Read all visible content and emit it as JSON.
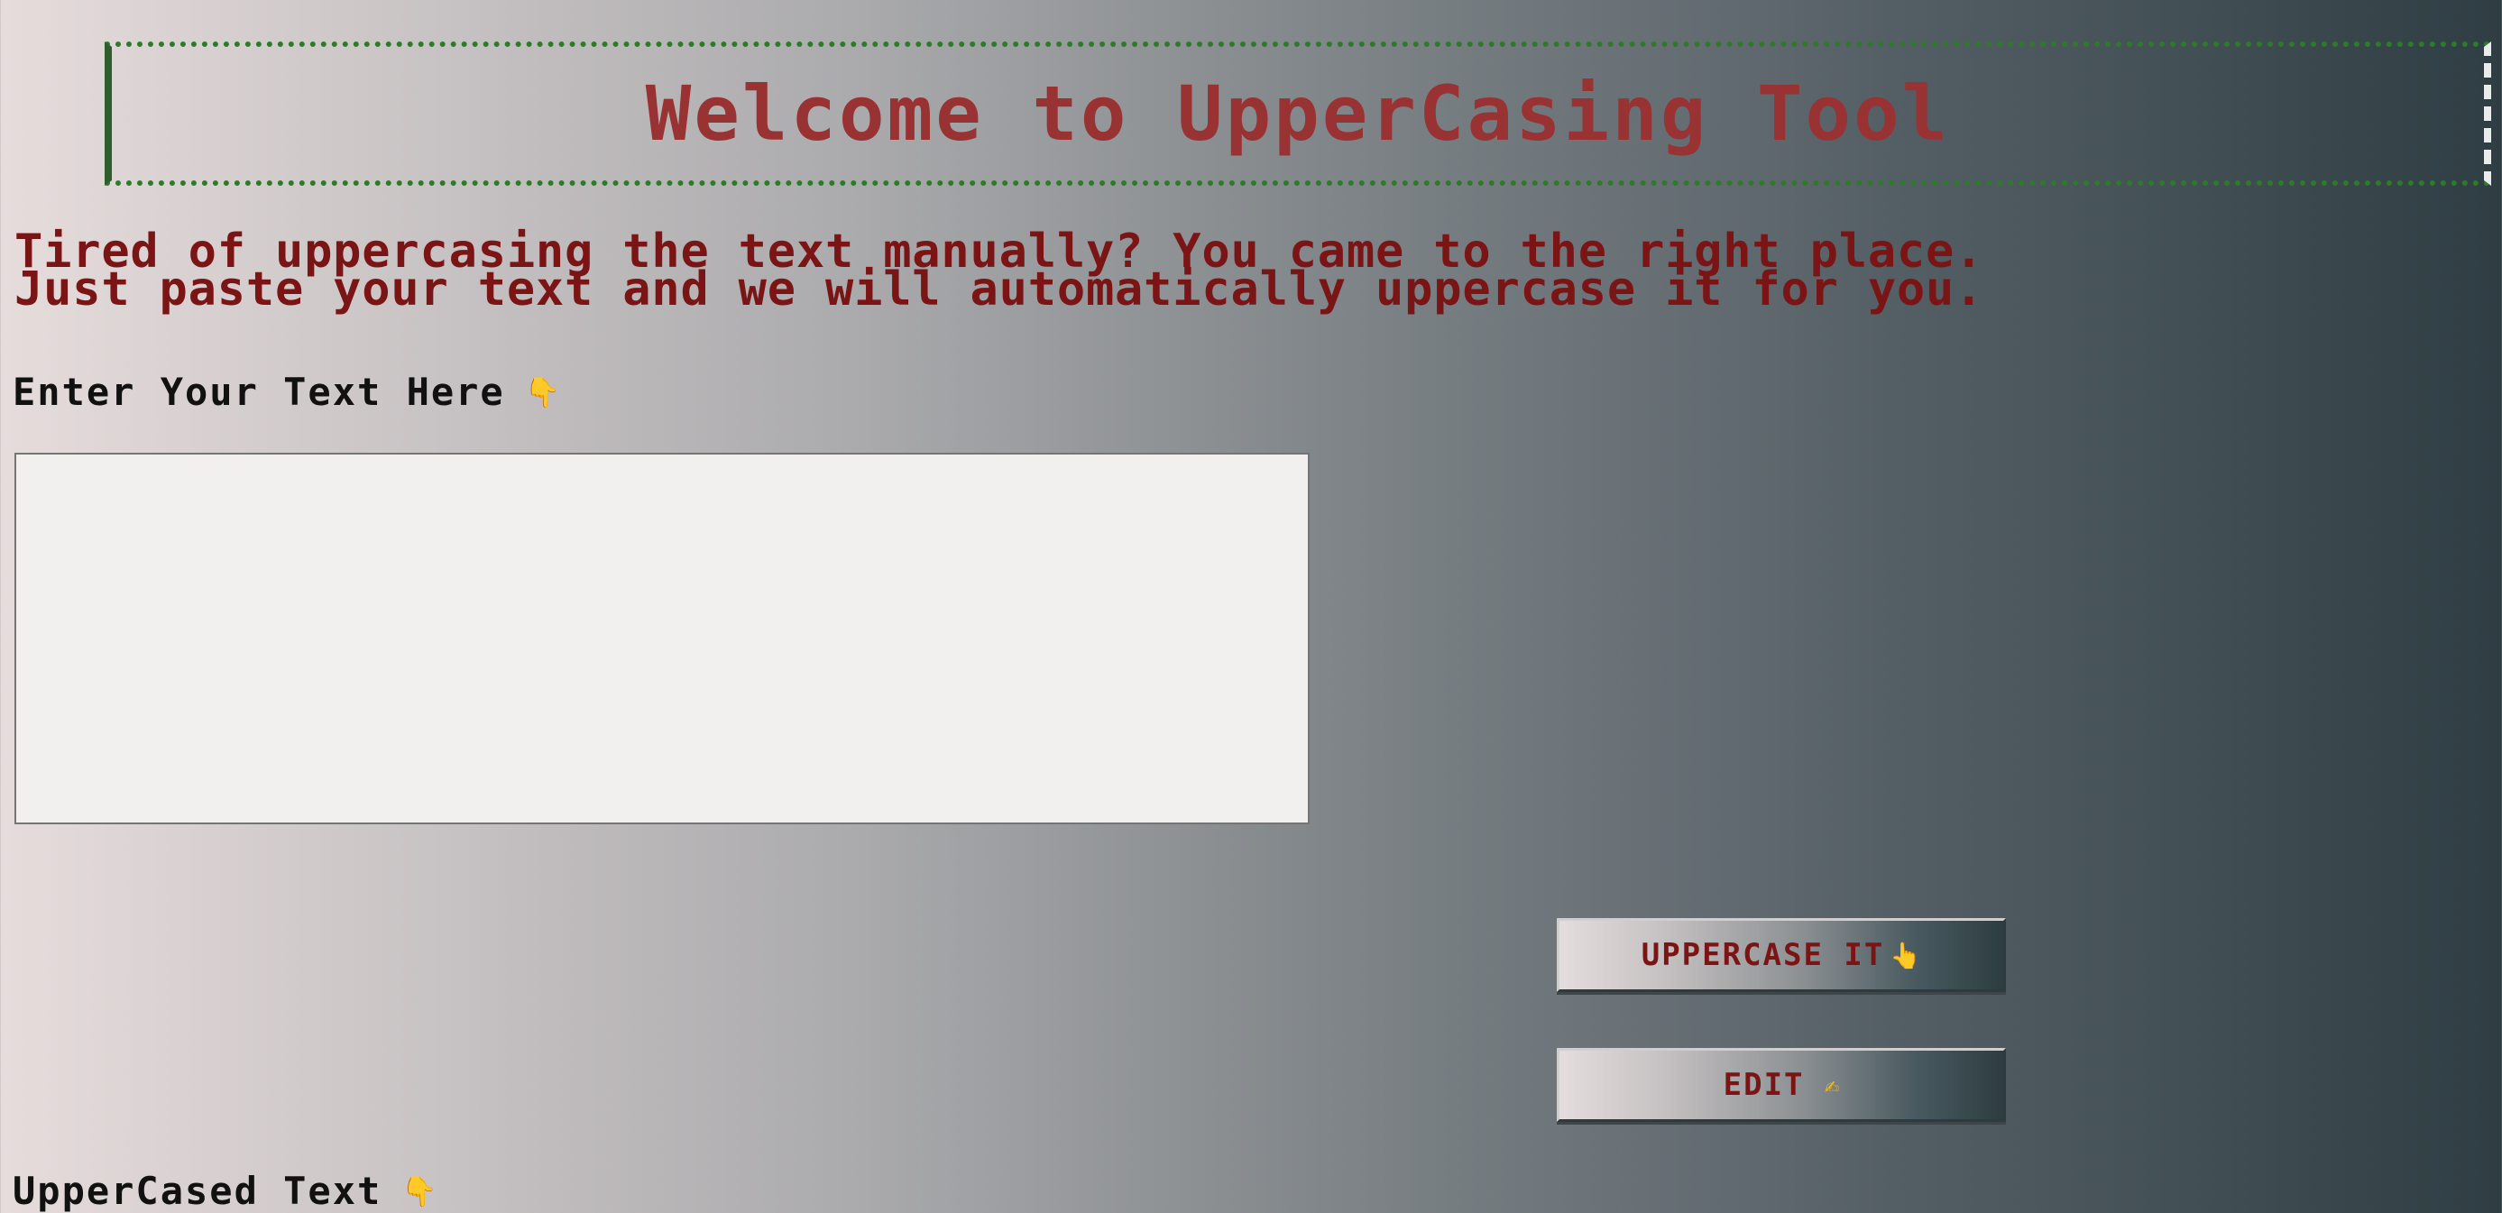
{
  "banner": {
    "title": "Welcome to UpperCasing Tool"
  },
  "intro": {
    "line1": "Tired of uppercasing the text manually? You came to the right place.",
    "line2": "Just paste your text and we will automatically uppercase it for you."
  },
  "input_section": {
    "label": "Enter Your Text Here",
    "icon": "pointing-down-hand-icon",
    "icon_glyph": "👇",
    "value": "",
    "placeholder": ""
  },
  "buttons": {
    "uppercase": {
      "label": "UPPERCASE IT",
      "icon": "pointing-up-hand-icon",
      "icon_glyph": "👆"
    },
    "edit": {
      "label": "EDIT",
      "icon": "writing-hand-icon",
      "icon_glyph": "✍"
    }
  },
  "output_section": {
    "label": "UpperCased Text",
    "icon": "pointing-down-hand-icon",
    "icon_glyph": "👇"
  },
  "colors": {
    "banner_title": "#993333",
    "intro_text": "#7b1515",
    "label_text": "#111111",
    "banner_border": "#2f7a2a",
    "textarea_bg": "#f2efef"
  }
}
